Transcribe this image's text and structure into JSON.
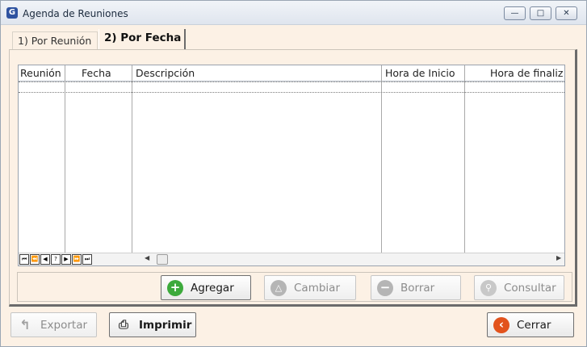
{
  "window": {
    "title": "Agenda de Reuniones",
    "app_icon_glyph": "G",
    "controls": {
      "minimize": "—",
      "maximize": "□",
      "close": "✕"
    }
  },
  "tabs": [
    {
      "label": "1) Por Reunión",
      "selected": false
    },
    {
      "label": "2)  Por Fecha",
      "selected": true
    }
  ],
  "grid": {
    "columns": [
      "Reunión",
      "Fecha",
      "Descripción",
      "Hora de Inicio",
      "Hora de finaliz"
    ],
    "rows": [],
    "navigator": [
      "⏮",
      "⏪",
      "◀",
      "?",
      "▶",
      "⏩",
      "⏭"
    ]
  },
  "actions": {
    "agregar": {
      "label": "Agregar",
      "icon": "plus-circle-icon",
      "color": "#3caa3c",
      "enabled": true
    },
    "cambiar": {
      "label": "Cambiar",
      "icon": "triangle-circle-icon",
      "color": "#b5b5b5",
      "enabled": false
    },
    "borrar": {
      "label": "Borrar",
      "icon": "minus-circle-icon",
      "color": "#b5b5b5",
      "enabled": false
    },
    "consultar": {
      "label": "Consultar",
      "icon": "people-search-icon",
      "color": "#b5b5b5",
      "enabled": false
    }
  },
  "footer": {
    "exportar": {
      "label": "Exportar",
      "icon": "export-arrow-icon",
      "enabled": false
    },
    "imprimir": {
      "label": "Imprimir",
      "icon": "printer-icon",
      "enabled": true
    },
    "cerrar": {
      "label": "Cerrar",
      "icon": "back-arrow-icon",
      "color": "#e2531d",
      "enabled": true
    }
  }
}
